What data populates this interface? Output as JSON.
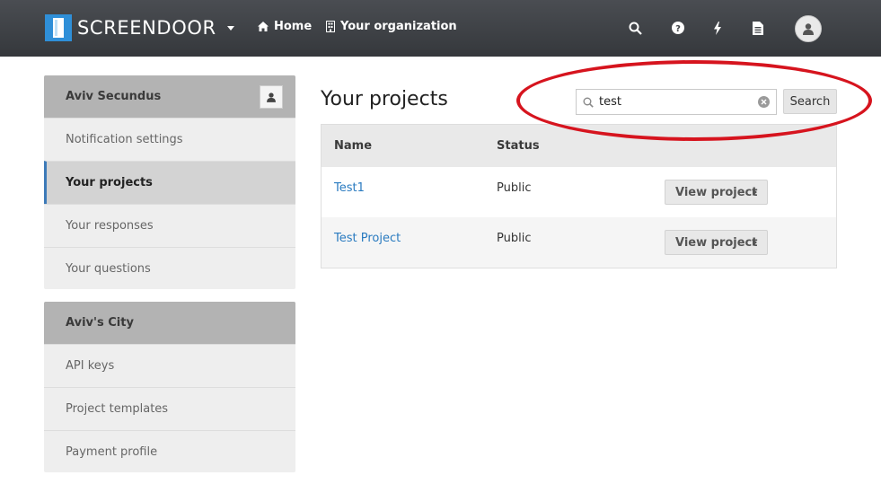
{
  "navbar": {
    "brand": "SCREENDOOR",
    "links": {
      "home": "Home",
      "organization": "Your organization"
    },
    "icons": [
      "search-icon",
      "help-icon",
      "bolt-icon",
      "document-icon",
      "user-avatar-icon"
    ]
  },
  "sidebar": {
    "account": {
      "title": "Aviv Secundus",
      "items": [
        {
          "label": "Notification settings"
        },
        {
          "label": "Your projects"
        },
        {
          "label": "Your responses"
        },
        {
          "label": "Your questions"
        }
      ]
    },
    "organization": {
      "title": "Aviv's City",
      "items": [
        {
          "label": "API keys"
        },
        {
          "label": "Project templates"
        },
        {
          "label": "Payment profile"
        }
      ]
    }
  },
  "main": {
    "title": "Your projects",
    "search": {
      "value": "test",
      "button_label": "Search"
    },
    "table": {
      "headers": {
        "name": "Name",
        "status": "Status"
      },
      "rows": [
        {
          "name": "Test1",
          "status": "Public",
          "action": "View project"
        },
        {
          "name": "Test Project",
          "status": "Public",
          "action": "View project"
        }
      ]
    }
  },
  "colors": {
    "link": "#2a7bc0",
    "brand": "#2f8fd8",
    "annotation": "#d6141e",
    "navbar": "#3f4246"
  }
}
